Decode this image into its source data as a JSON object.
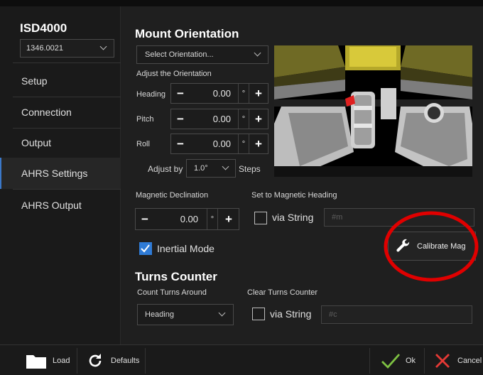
{
  "app": {
    "title": "ISD4000",
    "device": "1346.0021"
  },
  "sidebar": {
    "items": [
      {
        "label": "Setup"
      },
      {
        "label": "Connection"
      },
      {
        "label": "Output"
      },
      {
        "label": "AHRS Settings",
        "selected": true
      },
      {
        "label": "AHRS Output"
      }
    ]
  },
  "mount": {
    "title": "Mount Orientation",
    "select_placeholder": "Select Orientation...",
    "adjust_label": "Adjust the Orientation",
    "heading": {
      "label": "Heading",
      "value": "0.00",
      "unit": "°"
    },
    "pitch": {
      "label": "Pitch",
      "value": "0.00",
      "unit": "°"
    },
    "roll": {
      "label": "Roll",
      "value": "0.00",
      "unit": "°"
    },
    "adjust_by_label": "Adjust by",
    "adjust_by_value": "1.0°",
    "steps_label": "Steps"
  },
  "magnetic": {
    "declination_label": "Magnetic Declination",
    "declination_value": "0.00",
    "unit": "°",
    "set_heading_label": "Set to Magnetic Heading",
    "via_string_label": "via String",
    "string_placeholder": "#m",
    "calibrate_label": "Calibrate Mag",
    "inertial_label": "Inertial Mode",
    "inertial_checked": true
  },
  "turns": {
    "title": "Turns Counter",
    "count_label": "Count Turns Around",
    "count_value": "Heading",
    "clear_label": "Clear Turns Counter",
    "via_string_label": "via String",
    "string_placeholder": "#c"
  },
  "footer": {
    "load_label": "Load",
    "defaults_label": "Defaults",
    "ok_label": "Ok",
    "cancel_label": "Cancel"
  },
  "colors": {
    "accent": "#2f7bd6",
    "annotation_circle": "#e00000",
    "ok_check": "#7ec242",
    "cancel_x": "#e53935"
  },
  "icons": [
    "folder-icon",
    "refresh-icon",
    "wrench-icon",
    "checkmark-icon",
    "close-icon",
    "chevron-down-icon"
  ]
}
